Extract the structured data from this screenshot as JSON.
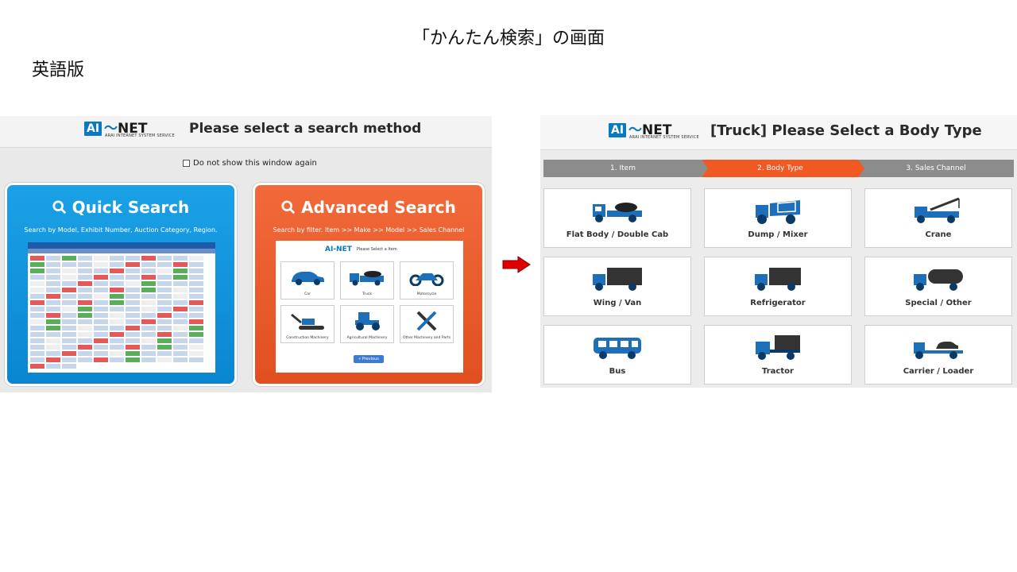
{
  "slide": {
    "title": "「かんたん検索」の画面",
    "subtitle": "英語版"
  },
  "left_window": {
    "logo_box": "AI",
    "logo_text": "NET",
    "logo_sub": "ARAI INTERNET SYSTEM SERVICE",
    "heading": "Please select a search method",
    "checkbox_label": "Do not show this window again",
    "quick": {
      "title": "Quick Search",
      "description": "Search by Model, Exhibit Number, Auction Category, Region."
    },
    "advanced": {
      "title": "Advanced Search",
      "description": "Search by filter. Item >> Make >> Model >> Sales Channel",
      "mock_logo": "AI-NET",
      "mock_heading": "Please Select a Item",
      "items": [
        {
          "label": "Car",
          "icon": "car-icon"
        },
        {
          "label": "Truck",
          "icon": "truck-icon"
        },
        {
          "label": "Motorcycle",
          "icon": "motorcycle-icon"
        },
        {
          "label": "Construction Machinery",
          "icon": "excavator-icon"
        },
        {
          "label": "Agricultural Machinery",
          "icon": "tractor-icon"
        },
        {
          "label": "Other Machinery and Parts",
          "icon": "tools-icon"
        }
      ],
      "previous_label": "« Previous"
    }
  },
  "right_window": {
    "logo_box": "AI",
    "logo_text": "NET",
    "logo_sub": "ARAI INTERNET SYSTEM SERVICE",
    "heading": "[Truck] Please Select a Body Type",
    "steps": [
      "1. Item",
      "2. Body Type",
      "3. Sales Channel"
    ],
    "active_step": 2,
    "body_types": [
      {
        "label": "Flat Body / Double Cab",
        "icon": "flatbed-truck-icon"
      },
      {
        "label": "Dump / Mixer",
        "icon": "dump-truck-icon"
      },
      {
        "label": "Crane",
        "icon": "crane-truck-icon"
      },
      {
        "label": "Wing / Van",
        "icon": "van-truck-icon"
      },
      {
        "label": "Refrigerator",
        "icon": "refrigerator-truck-icon"
      },
      {
        "label": "Special / Other",
        "icon": "tanker-truck-icon"
      },
      {
        "label": "Bus",
        "icon": "bus-icon"
      },
      {
        "label": "Tractor",
        "icon": "tractor-head-icon"
      },
      {
        "label": "Carrier / Loader",
        "icon": "car-carrier-icon"
      }
    ]
  },
  "colors": {
    "brand_blue": "#0a78c2",
    "quick_blue": "#1ba1e6",
    "advanced_orange": "#e85a28",
    "step_active": "#f05a22",
    "step_inactive": "#8c8c8c",
    "arrow_red": "#e00000",
    "icon_blue": "#1c6fb8"
  }
}
